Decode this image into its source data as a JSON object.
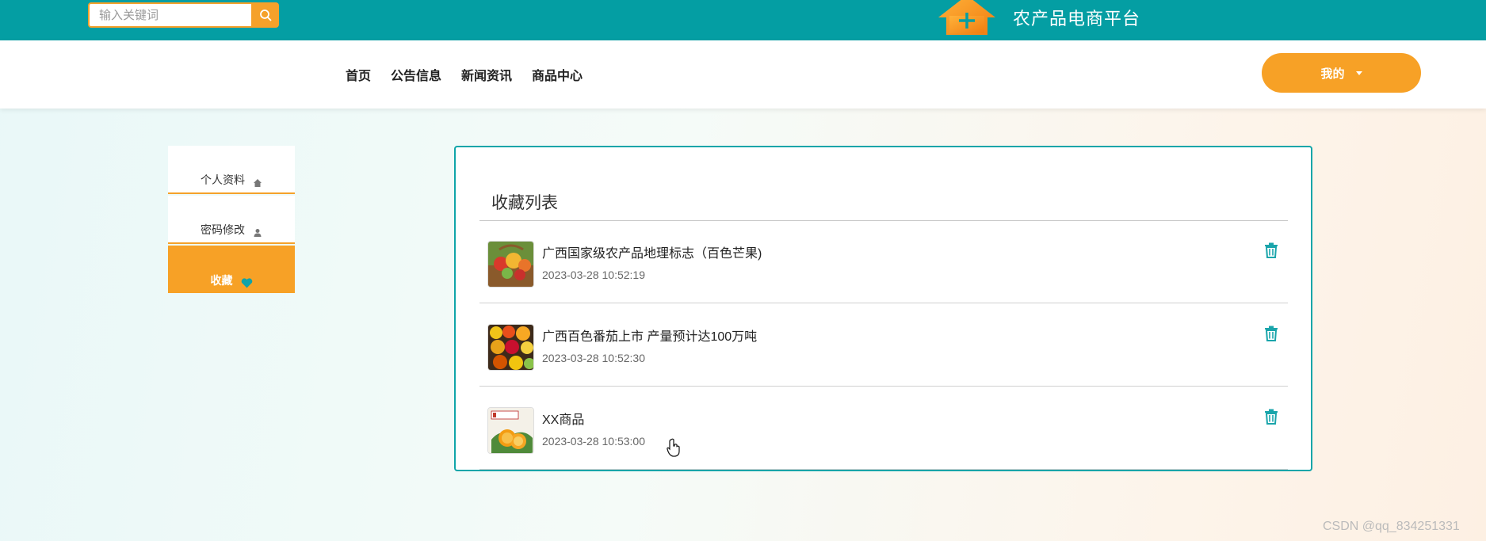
{
  "search": {
    "placeholder": "输入关键词"
  },
  "brand": {
    "title": "农产品电商平台",
    "colors": {
      "topbar": "#049ea3",
      "accent": "#f7a126"
    }
  },
  "nav": {
    "links": [
      "首页",
      "公告信息",
      "新闻资讯",
      "商品中心"
    ]
  },
  "user_menu": {
    "label": "我的"
  },
  "sidebar": {
    "items": [
      {
        "label": "个人资料",
        "icon": "home-icon"
      },
      {
        "label": "密码修改",
        "icon": "user-icon"
      },
      {
        "label": "收藏",
        "icon": "heart-icon",
        "active": true
      }
    ]
  },
  "favorites": {
    "title": "收藏列表",
    "items": [
      {
        "name": "广西国家级农产品地理标志（百色芒果)",
        "time": "2023-03-28 10:52:19",
        "thumb": "fruit-basket-image"
      },
      {
        "name": "广西百色番茄上市 产量预计达100万吨",
        "time": "2023-03-28 10:52:30",
        "thumb": "fruit-market-image"
      },
      {
        "name": "XX商品",
        "time": "2023-03-28 10:53:00",
        "thumb": "orange-product-image"
      }
    ]
  },
  "watermark": "CSDN @qq_834251331"
}
